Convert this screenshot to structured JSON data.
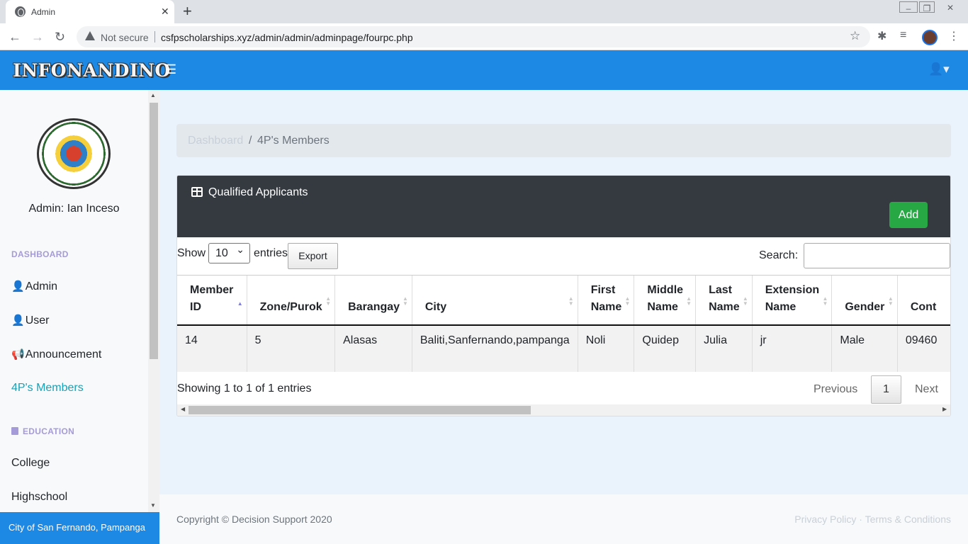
{
  "browser": {
    "tab_title": "Admin",
    "new_tab": "+",
    "close_tab": "✕",
    "security_label": "Not secure",
    "url": "csfpscholarships.xyz/admin/admin/adminpage/fourpc.php"
  },
  "navbar": {
    "brand": "INFONANDINO",
    "accent": "#1e88e5"
  },
  "sidebar": {
    "admin_label": "Admin: Ian Inceso",
    "sections": [
      {
        "heading": "DASHBOARD"
      },
      {
        "heading": "EDUCATION"
      }
    ],
    "items": [
      {
        "label": "Admin",
        "icon": "user-icon"
      },
      {
        "label": "User",
        "icon": "user-icon"
      },
      {
        "label": "Announcement",
        "icon": "megaphone-icon"
      },
      {
        "label": "4P's Members",
        "active": true
      },
      {
        "label": "College"
      },
      {
        "label": "Highschool"
      }
    ],
    "footer": "City of San Fernando, Pampanga"
  },
  "breadcrumb": {
    "link": "Dashboard",
    "separator": "/",
    "current": "4P's Members"
  },
  "card": {
    "title": "Qualified Applicants",
    "add_label": "Add",
    "show_label": "Show",
    "page_length": "10",
    "entries_label": "entries",
    "export_label": "Export",
    "search_label": "Search:",
    "search_value": ""
  },
  "table": {
    "columns": [
      "Member ID",
      "Zone/Purok",
      "Barangay",
      "City",
      "First Name",
      "Middle Name",
      "Last Name",
      "Extension Name",
      "Gender",
      "Cont"
    ],
    "rows": [
      [
        "14",
        "5",
        "Alasas",
        "Baliti,Sanfernando,pampanga",
        "Noli",
        "Quidep",
        "Julia",
        "jr",
        "Male",
        "09460"
      ]
    ]
  },
  "pagination": {
    "info": "Showing 1 to 1 of 1 entries",
    "previous": "Previous",
    "page": "1",
    "next": "Next"
  },
  "footer": {
    "copyright": "Copyright © Decision Support 2020",
    "privacy": "Privacy Policy",
    "dot": "·",
    "terms": "Terms & Conditions"
  }
}
